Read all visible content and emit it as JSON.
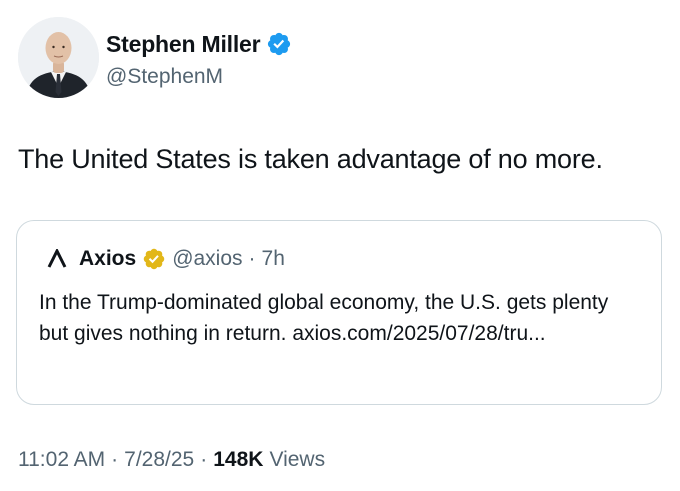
{
  "author": {
    "display_name": "Stephen Miller",
    "handle": "@StephenM",
    "verified_color": "#1d9bf0"
  },
  "tweet": {
    "text": "The United States is taken advantage of no more."
  },
  "quoted_tweet": {
    "author_name": "Axios",
    "handle": "@axios",
    "separator": "·",
    "time": "7h",
    "verified_color": "#e2b719",
    "text": "In the Trump-dominated global economy, the U.S. gets plenty but gives nothing in return. axios.com/2025/07/28/tru..."
  },
  "meta": {
    "time": "11:02 AM",
    "separator": "·",
    "date": "7/28/25",
    "views_count": "148K",
    "views_label": "Views"
  },
  "icons": {
    "author_avatar": "avatar-photo",
    "verified": "verified-badge-icon",
    "axios_logo": "axios-logo-icon",
    "gold_verified": "gold-verified-badge-icon"
  },
  "colors": {
    "text_primary": "#0f1419",
    "text_secondary": "#536471",
    "border": "#cfd9de"
  }
}
